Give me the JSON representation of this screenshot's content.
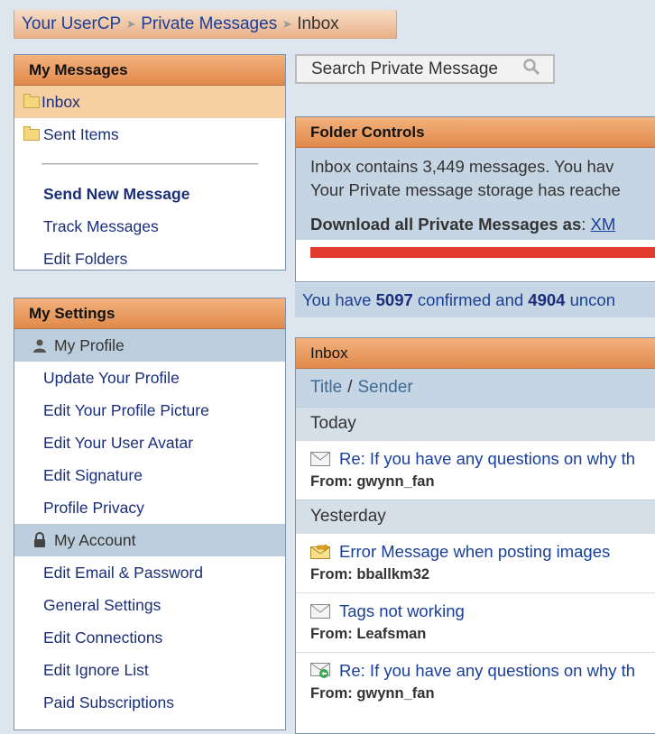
{
  "breadcrumb": {
    "items": [
      "Your UserCP",
      "Private Messages"
    ],
    "current": "Inbox"
  },
  "my_messages": {
    "title": "My Messages",
    "folders": [
      {
        "label": "Inbox",
        "active": true
      },
      {
        "label": "Sent Items",
        "active": false
      }
    ],
    "links": [
      "Send New Message",
      "Track Messages",
      "Edit Folders"
    ]
  },
  "my_settings": {
    "title": "My Settings",
    "profile_group": "My Profile",
    "profile_links": [
      "Update Your Profile",
      "Edit Your Profile Picture",
      "Edit Your User Avatar",
      "Edit Signature",
      "Profile Privacy"
    ],
    "account_group": "My Account",
    "account_links": [
      "Edit Email & Password",
      "General Settings",
      "Edit Connections",
      "Edit Ignore List",
      "Paid Subscriptions"
    ]
  },
  "search": {
    "placeholder": "Search Private Message"
  },
  "folder_controls": {
    "title": "Folder Controls",
    "line1": "Inbox contains 3,449 messages. You hav",
    "line2": "Your Private message storage has reache",
    "download_label": "Download all Private Messages as",
    "download_colon": ":",
    "download_link": "XM",
    "storage_fill": 1.0
  },
  "confirmed": {
    "pre": "You have ",
    "confirmed_count": "5097",
    "mid": " confirmed and ",
    "unconfirmed_count": "4904",
    "post": " uncon"
  },
  "inbox": {
    "title": "Inbox",
    "col_title": "Title",
    "col_sep": "/",
    "col_sender": "Sender",
    "from_label": "From:",
    "groups": [
      {
        "day": "Today",
        "messages": [
          {
            "title": "Re: If you have any questions on why th",
            "sender": "gwynn_fan",
            "icon": "envelope-icon"
          }
        ]
      },
      {
        "day": "Yesterday",
        "messages": [
          {
            "title": "Error Message when posting images",
            "sender": "bballkm32",
            "icon": "forwarded-envelope-icon"
          },
          {
            "title": "Tags not working",
            "sender": "Leafsman",
            "icon": "envelope-icon"
          },
          {
            "title": "Re: If you have any questions on why th",
            "sender": "gwynn_fan",
            "icon": "replied-envelope-icon"
          }
        ]
      }
    ]
  },
  "colors": {
    "header_orange": "#e08a4c",
    "link_blue": "#1a3f9a",
    "storage_bar": "#e23a2e",
    "active_folder": "#f6d0a3"
  }
}
